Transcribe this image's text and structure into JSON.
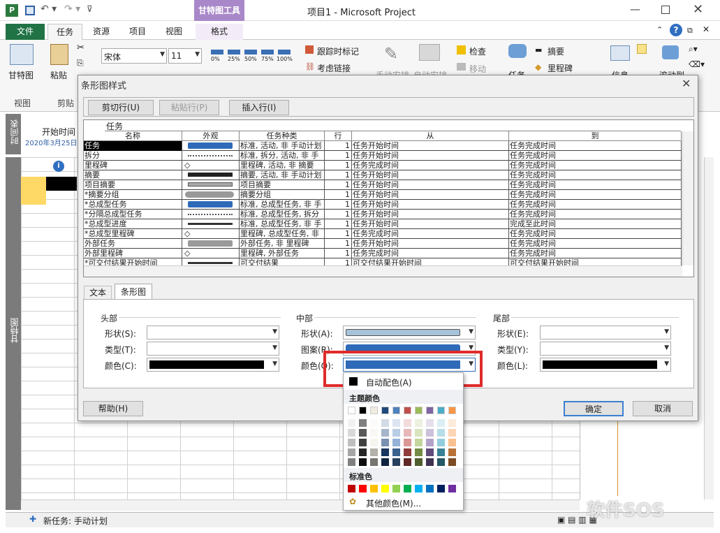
{
  "window": {
    "title": "项目1 - Microsoft Project",
    "tool_tab": "甘特图工具"
  },
  "tabs": {
    "file": "文件",
    "task": "任务",
    "resource": "资源",
    "project": "项目",
    "view": "视图",
    "format": "格式"
  },
  "ribbon": {
    "gantt": "甘特图",
    "paste": "粘贴",
    "font_name": "宋体",
    "font_size": "11",
    "track": "跟踪时标记",
    "link": "考虑链接",
    "manual": "手动安排",
    "auto": "自动安排",
    "inspect": "检查",
    "move": "移动",
    "task": "任务",
    "summary": "摘要",
    "milestone": "里程碑",
    "info": "信息",
    "scroll": "滚动到",
    "group_view": "视图",
    "group_clip": "剪贴",
    "bar_labels": [
      "0%",
      "25%",
      "50%",
      "75%",
      "100%"
    ]
  },
  "left": {
    "timeline": "时间表",
    "gantt_side": "甘特图",
    "start_label": "开始时间",
    "start_date": "2020年3月25日"
  },
  "status": {
    "new_task": "新任务: 手动计划"
  },
  "watermark": "软件SOS",
  "dialog": {
    "title": "条形图样式",
    "cut": "剪切行(U)",
    "paste": "粘贴行(P)",
    "insert": "插入行(I)",
    "cols": {
      "name": "名称",
      "appearance": "外观",
      "kind": "任务种类",
      "row": "行",
      "from": "从",
      "to": "到"
    },
    "entry": "任务",
    "rows": [
      {
        "name": "任务",
        "kind": "标准, 活动, 非 手动计划",
        "row": "1",
        "from": "任务开始时间",
        "to": "任务完成时间"
      },
      {
        "name": "拆分",
        "kind": "标准, 拆分, 活动, 非 手",
        "row": "1",
        "from": "任务开始时间",
        "to": "任务完成时间"
      },
      {
        "name": "里程碑",
        "kind": "里程碑, 活动, 非 摘要",
        "row": "1",
        "from": "任务完成时间",
        "to": "任务完成时间"
      },
      {
        "name": "摘要",
        "kind": "摘要, 活动, 非 手动计划",
        "row": "1",
        "from": "任务开始时间",
        "to": "任务完成时间"
      },
      {
        "name": "项目摘要",
        "kind": "项目摘要",
        "row": "1",
        "from": "任务开始时间",
        "to": "任务完成时间"
      },
      {
        "name": "*摘要分组",
        "kind": "摘要分组",
        "row": "1",
        "from": "任务开始时间",
        "to": "任务完成时间"
      },
      {
        "name": "*总成型任务",
        "kind": "标准, 总成型任务, 非 手",
        "row": "1",
        "from": "任务开始时间",
        "to": "任务完成时间"
      },
      {
        "name": "*分隔总成型任务",
        "kind": "标准, 总成型任务, 拆分",
        "row": "1",
        "from": "任务开始时间",
        "to": "任务完成时间"
      },
      {
        "name": "*总成型进度",
        "kind": "标准, 总成型任务, 非 手",
        "row": "1",
        "from": "任务开始时间",
        "to": "完成至此时间"
      },
      {
        "name": "*总成型里程碑",
        "kind": "里程碑, 总成型任务, 非",
        "row": "1",
        "from": "任务完成时间",
        "to": "任务完成时间"
      },
      {
        "name": "外部任务",
        "kind": "外部任务, 非 里程碑",
        "row": "1",
        "from": "任务开始时间",
        "to": "任务完成时间"
      },
      {
        "name": "外部里程碑",
        "kind": "里程碑, 外部任务",
        "row": "1",
        "from": "任务完成时间",
        "to": "任务完成时间"
      },
      {
        "name": "*可交付结果开始时间",
        "kind": "可交付结果",
        "row": "1",
        "from": "可交付结果开始时间",
        "to": "可交付结果开始时间"
      }
    ],
    "tab_text": "文本",
    "tab_bar": "条形图",
    "head": {
      "title": "头部",
      "shape": "形状(S):",
      "type": "类型(T):",
      "color": "颜色(C):"
    },
    "middle": {
      "title": "中部",
      "shape": "形状(A):",
      "pattern": "图案(R):",
      "color": "颜色(O):"
    },
    "tail": {
      "title": "尾部",
      "shape": "形状(E):",
      "type": "类型(Y):",
      "color": "颜色(L):"
    },
    "help": "帮助(H)",
    "ok": "确定",
    "cancel": "取消"
  },
  "palette": {
    "auto": "自动配色(A)",
    "theme": "主题颜色",
    "standard": "标准色",
    "more": "其他颜色(M)...",
    "theme_top": [
      "#ffffff",
      "#000000",
      "#eeece1",
      "#1f497d",
      "#4f81bd",
      "#c0504d",
      "#9bbb59",
      "#8064a2",
      "#4bacc6",
      "#f79646"
    ],
    "standard_colors": [
      "#c00000",
      "#ff0000",
      "#ffc000",
      "#ffff00",
      "#92d050",
      "#00b050",
      "#00b0f0",
      "#0070c0",
      "#002060",
      "#7030a0"
    ]
  },
  "colors": {
    "accent": "#217346",
    "bar_blue": "#2e6ab8",
    "highlight": "#e02b2b",
    "tool_tab": "#a988c9"
  }
}
